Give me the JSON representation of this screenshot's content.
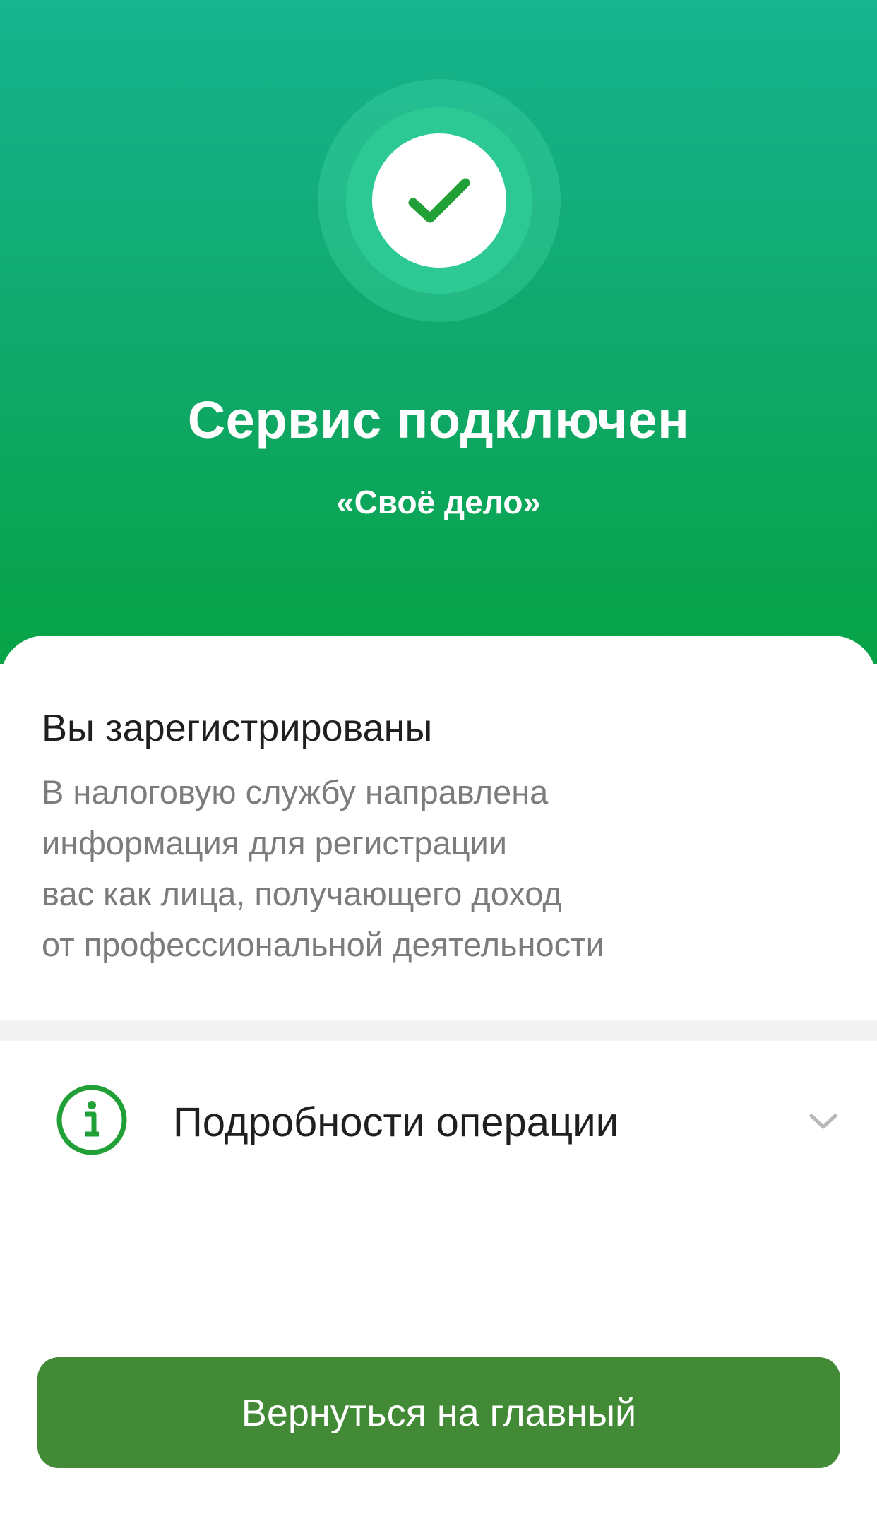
{
  "colors": {
    "hero_gradient_top": "#17b48f",
    "hero_gradient_bottom": "#07a346",
    "accent_green": "#21a038",
    "button_green": "#438a37",
    "text_primary": "#1f1f1f",
    "text_secondary": "#7c7c7c"
  },
  "status": {
    "icon": "check-icon",
    "title": "Сервис подключен",
    "subtitle": "«Своё дело»"
  },
  "registration": {
    "title": "Вы зарегистрированы",
    "lines": [
      "В налоговую службу направлена",
      "информация для регистрации",
      "вас как лица, получающего доход",
      "от профессиональной деятельности"
    ]
  },
  "details": {
    "icon": "info-icon",
    "label": "Подробности операции",
    "toggle_icon": "chevron-down-icon"
  },
  "actions": {
    "home_label": "Вернуться на главный"
  }
}
